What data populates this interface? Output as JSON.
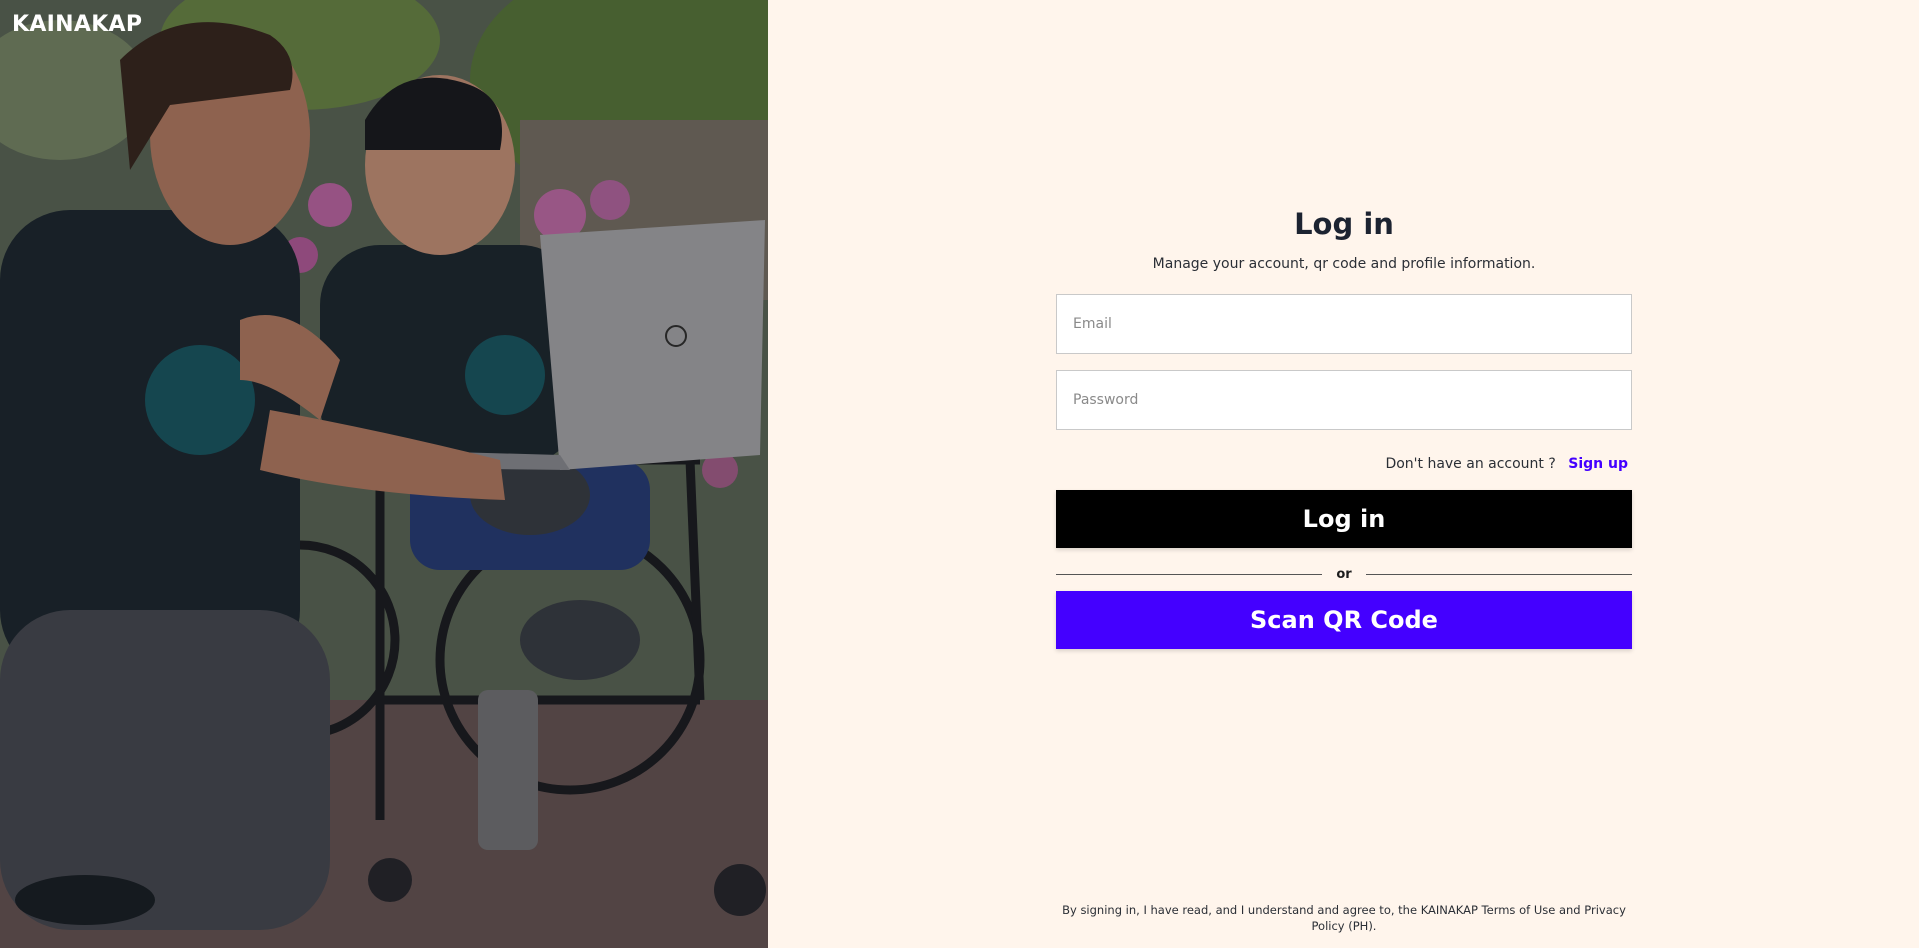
{
  "brand": {
    "name": "KAINAKAP"
  },
  "hero_image": {
    "description_icon": "photo"
  },
  "login": {
    "title": "Log in",
    "subtitle": "Manage your account, qr code and profile information.",
    "email_placeholder": "Email",
    "email_value": "",
    "password_placeholder": "Password",
    "password_value": "",
    "signup_prompt": "Don't have an account ?",
    "signup_link": "Sign up",
    "login_button": "Log in",
    "divider_text": "or",
    "qr_button": "Scan QR Code"
  },
  "footer": {
    "legal_text": "By signing in, I have read, and I understand and agree to, the KAINAKAP Terms of Use and Privacy Policy (PH)."
  },
  "colors": {
    "form_background": "#fff5ec",
    "login_button": "#000000",
    "qr_button": "#4400ff",
    "link": "#4400ff"
  }
}
